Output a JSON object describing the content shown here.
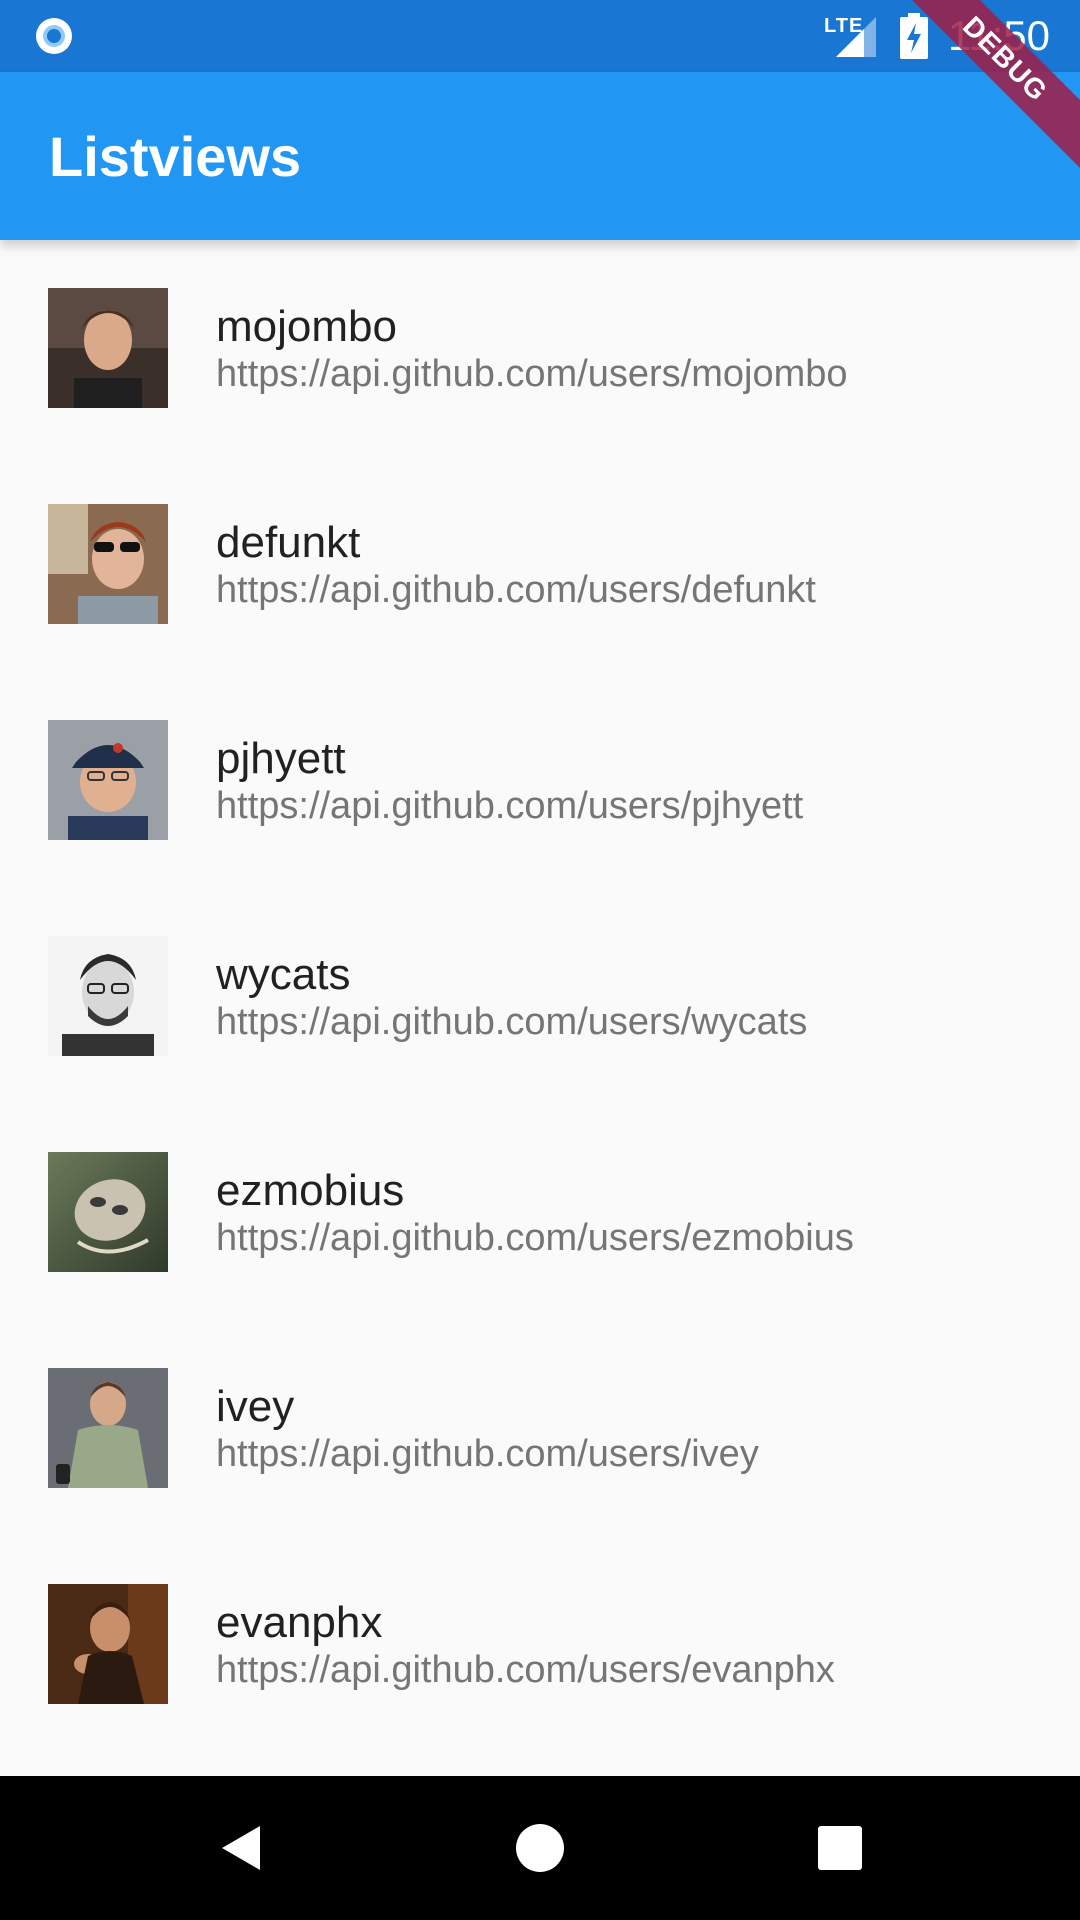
{
  "status_bar": {
    "network_label": "LTE",
    "time": "11:50",
    "icons": [
      "notification-circle-icon",
      "lte-signal-icon",
      "battery-charging-icon"
    ]
  },
  "app_bar": {
    "title": "Listviews",
    "debug_banner": "DEBUG",
    "color": "#2196f3"
  },
  "users": [
    {
      "login": "mojombo",
      "url": "https://api.github.com/users/mojombo"
    },
    {
      "login": "defunkt",
      "url": "https://api.github.com/users/defunkt"
    },
    {
      "login": "pjhyett",
      "url": "https://api.github.com/users/pjhyett"
    },
    {
      "login": "wycats",
      "url": "https://api.github.com/users/wycats"
    },
    {
      "login": "ezmobius",
      "url": "https://api.github.com/users/ezmobius"
    },
    {
      "login": "ivey",
      "url": "https://api.github.com/users/ivey"
    },
    {
      "login": "evanphx",
      "url": "https://api.github.com/users/evanphx"
    }
  ],
  "nav_bar": {
    "buttons": [
      "back-icon",
      "home-icon",
      "recents-icon"
    ]
  },
  "colors": {
    "status_bar": "#1976d2",
    "primary": "#2196f3",
    "debug_ribbon": "#a01e46"
  }
}
